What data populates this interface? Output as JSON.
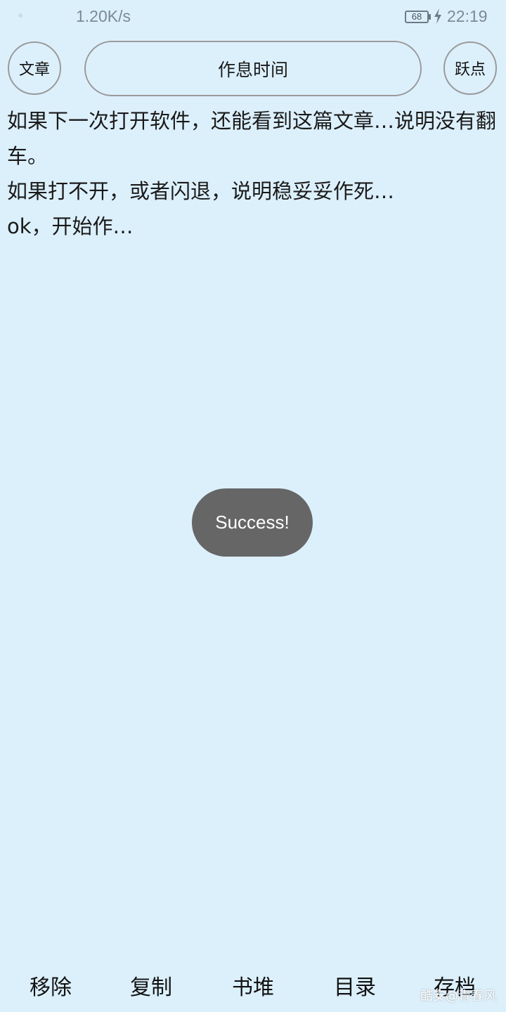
{
  "status_bar": {
    "net_speed": "1.20K/s",
    "battery": "68",
    "time": "22:19"
  },
  "header": {
    "left_button": "文章",
    "title": "作息时间",
    "right_button": "跃点"
  },
  "article": {
    "lines": [
      "如果下一次打开软件，还能看到这篇文章…说明没有翻车。",
      "如果打不开，或者闪退，说明稳妥妥作死…",
      "ok，开始作…"
    ]
  },
  "toast": {
    "message": "Success!"
  },
  "bottom_bar": {
    "items": [
      "移除",
      "复制",
      "书堆",
      "目录",
      "存档"
    ]
  },
  "watermark": "酷安@青春风",
  "colors": {
    "background": "#dcf0fc",
    "border": "#9a9a9a",
    "toast_bg": "#666666"
  }
}
